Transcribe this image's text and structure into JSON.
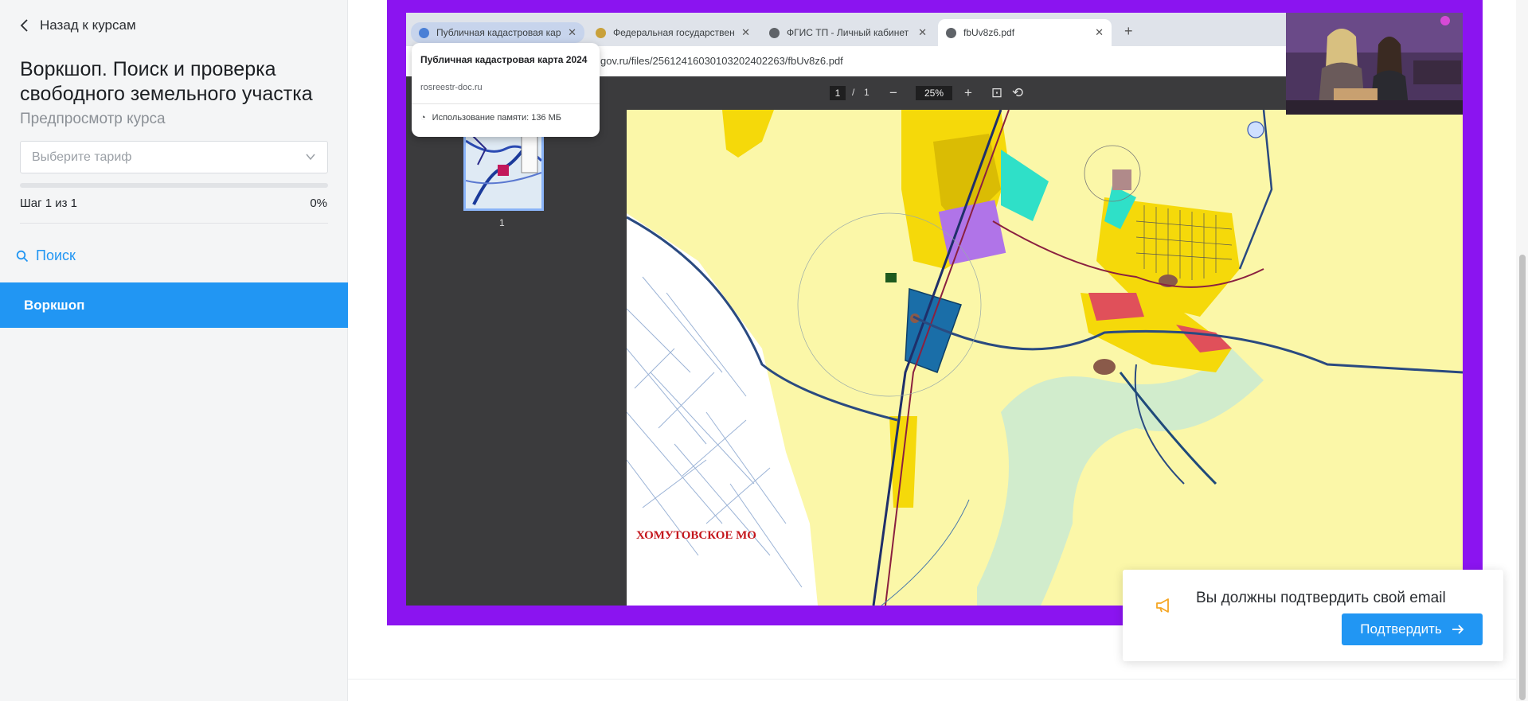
{
  "sidebar": {
    "back_label": "Назад к курсам",
    "course_title": "Воркшоп. Поиск и проверка свободного земельного участка",
    "course_subtitle": "Предпросмотр курса",
    "tariff_placeholder": "Выберите тариф",
    "progress_percent": 0,
    "step_label": "Шаг 1 из 1",
    "step_percent_label": "0%",
    "search_label": "Поиск",
    "active_item_label": "Воркшоп"
  },
  "video": {
    "browser": {
      "tabs": [
        {
          "label": "Публичная кадастровая кар",
          "icon": "globe-blue-icon"
        },
        {
          "label": "Федеральная государствен",
          "icon": "emblem-icon"
        },
        {
          "label": "ФГИС ТП - Личный кабинет",
          "icon": "globe-icon"
        },
        {
          "label": "fbUv8z6.pdf",
          "icon": "globe-icon"
        }
      ],
      "url": "gov.ru/files/25612416030103202402263/fbUv8z6.pdf",
      "tooltip": {
        "title": "Публичная кадастровая карта 2024",
        "domain": "rosreestr-doc.ru",
        "memory": "Использование памяти: 136 МБ"
      }
    },
    "pdf": {
      "page_current": "1",
      "page_separator": "/",
      "page_total": "1",
      "zoom": "25%",
      "thumb_number": "1",
      "map_label": "ХОМУТОВСКОЕ МО"
    }
  },
  "notification": {
    "message": "Вы должны подтвердить свой email",
    "button_label": "Подтвердить"
  },
  "colors": {
    "accent": "#2196f3",
    "video_border": "#8b14f0",
    "map_label": "#c4161c",
    "notify_icon": "#f5a623"
  }
}
